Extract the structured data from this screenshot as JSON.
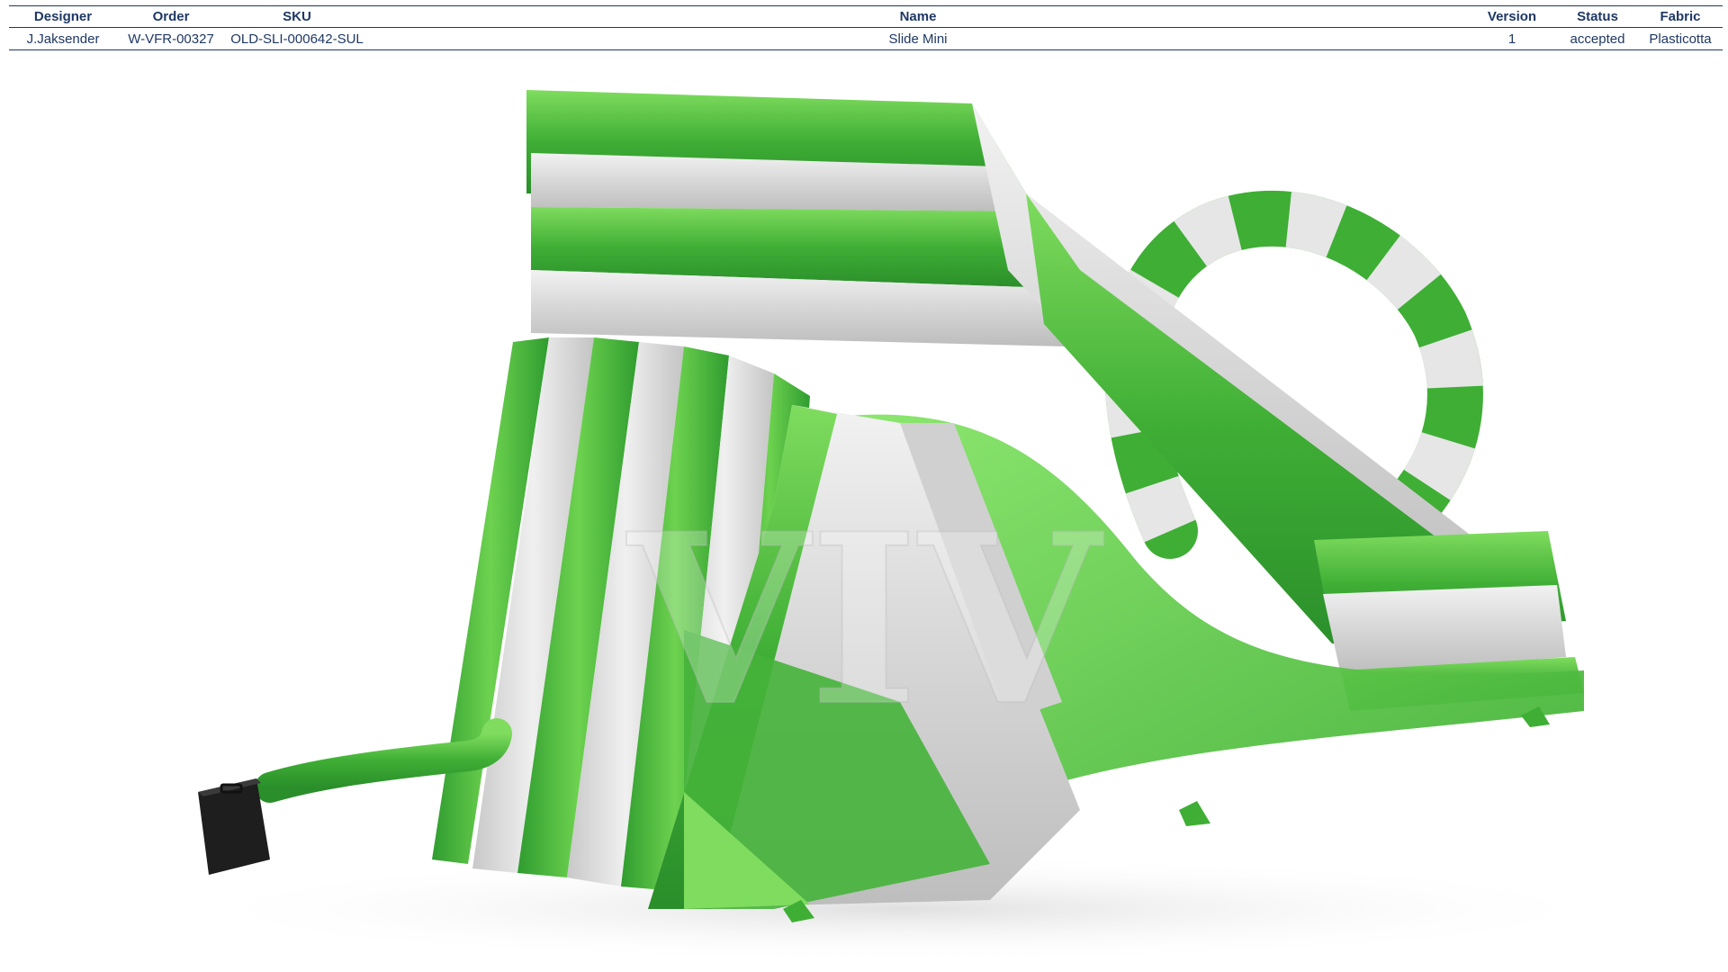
{
  "header": {
    "columns": [
      "Designer",
      "Order",
      "SKU",
      "Name",
      "Version",
      "Status",
      "Fabric"
    ],
    "row": {
      "designer": "J.Jaksender",
      "order": "W-VFR-00327",
      "sku": "OLD-SLI-000642-SUL",
      "name": "Slide Mini",
      "version": "1",
      "status": "accepted",
      "fabric": "Plasticotta"
    }
  },
  "render": {
    "colors": {
      "green_dark": "#2f9c2f",
      "green_light": "#6bd24e",
      "grey": "#dcdcdc",
      "blower": "#1e1e1e",
      "text": "#1f3864"
    },
    "watermark": "VIV"
  }
}
